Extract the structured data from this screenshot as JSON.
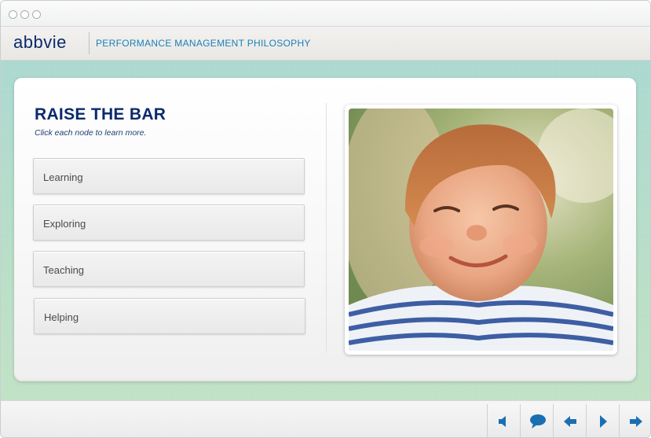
{
  "header": {
    "logo_text": "abbvie",
    "course_title": "PERFORMANCE MANAGEMENT PHILOSOPHY"
  },
  "slide": {
    "title": "RAISE THE BAR",
    "instructions": "Click each node to learn more.",
    "nodes": [
      {
        "label": "Learning"
      },
      {
        "label": "Exploring"
      },
      {
        "label": "Teaching"
      },
      {
        "label": "Helping"
      }
    ]
  },
  "footer": {
    "buttons": [
      {
        "icon": "speaker-icon"
      },
      {
        "icon": "speech-bubble-icon"
      },
      {
        "icon": "arrow-left-icon"
      },
      {
        "icon": "play-icon"
      },
      {
        "icon": "arrow-right-icon"
      }
    ]
  },
  "colors": {
    "brand_navy": "#0b2a6b",
    "accent_blue": "#1a7fb8",
    "icon_blue": "#1a6fb3",
    "stage_teal": "#a9d8cf"
  }
}
